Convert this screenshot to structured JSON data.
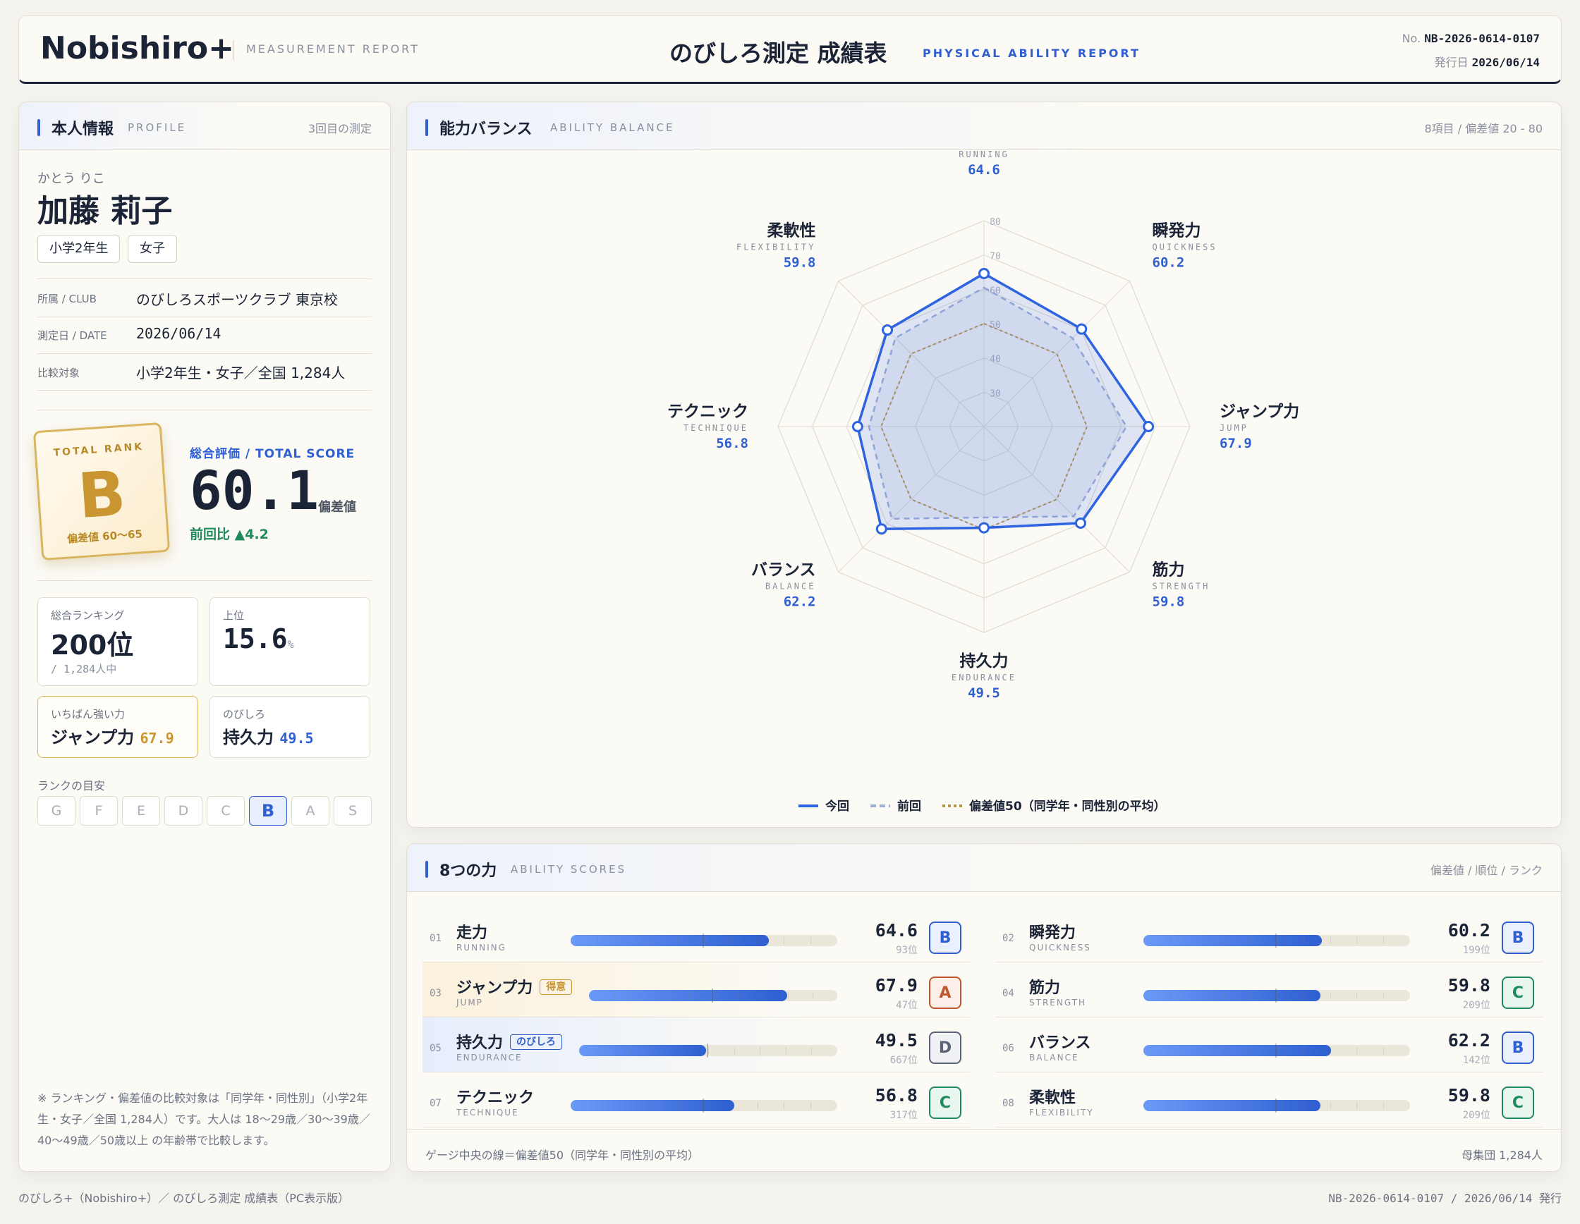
{
  "header": {
    "logo_main": "Nobishiro",
    "logo_plus": "+",
    "subtitle": "MEASUREMENT REPORT",
    "title": "のびしろ測定 成績表",
    "title_en": "PHYSICAL ABILITY REPORT",
    "no_label": "No.",
    "no_value": "NB-2026-0614-0107",
    "date_label": "発行日",
    "date_value": "2026/06/14"
  },
  "profile": {
    "title": "本人情報",
    "title_en": "PROFILE",
    "count": "3回目の測定",
    "kana": "かとう りこ",
    "name": "加藤 莉子",
    "grade": "小学2年生",
    "gender": "女子",
    "club_label": "所属 / CLUB",
    "club_value": "のびしろスポーツクラブ 東京校",
    "date_label": "測定日 / DATE",
    "date_value": "2026/06/14",
    "compare_label": "比較対象",
    "compare_value": "小学2年生・女子／全国 1,284人",
    "rank_card_label": "TOTAL RANK",
    "rank_card_grade": "B",
    "rank_card_range": "偏差値 60〜65",
    "total_label": "総合評価 / TOTAL SCORE",
    "total_value": "60.1",
    "total_unit": "偏差値",
    "diff": "前回比 ▲4.2",
    "ranking_label": "総合ランキング",
    "ranking_value": "200位",
    "ranking_sub": "/ 1,284人中",
    "top_label": "上位",
    "top_value": "15.6",
    "top_unit": "%",
    "strong_label": "いちばん強い力",
    "strong_name": "ジャンプ力",
    "strong_value": "67.9",
    "grow_label": "のびしろ",
    "grow_name": "持久力",
    "grow_value": "49.5",
    "guide_label": "ランクの目安",
    "grades": [
      "G",
      "F",
      "E",
      "D",
      "C",
      "B",
      "A",
      "S"
    ],
    "note": "※ ランキング・偏差値の比較対象は「同学年・同性別」（小学2年生・女子／全国 1,284人）です。大人は 18〜29歳／30〜39歳／40〜49歳／50歳以上 の年齢帯で比較します。"
  },
  "balance": {
    "title": "能力バランス",
    "title_en": "ABILITY BALANCE",
    "right": "8項目 / 偏差値 20 - 80",
    "legend_now": "今回",
    "legend_prev": "前回",
    "legend_avg": "偏差値50（同学年・同性別の平均）"
  },
  "chart_data": {
    "type": "radar",
    "axes": [
      {
        "name": "走力",
        "en": "RUNNING",
        "value": "64.6"
      },
      {
        "name": "瞬発力",
        "en": "QUICKNESS",
        "value": "60.2"
      },
      {
        "name": "ジャンプ力",
        "en": "JUMP",
        "value": "67.9"
      },
      {
        "name": "筋力",
        "en": "STRENGTH",
        "value": "59.8"
      },
      {
        "name": "持久力",
        "en": "ENDURANCE",
        "value": "49.5"
      },
      {
        "name": "バランス",
        "en": "BALANCE",
        "value": "62.2"
      },
      {
        "name": "テクニック",
        "en": "TECHNIQUE",
        "value": "56.8"
      },
      {
        "name": "柔軟性",
        "en": "FLEXIBILITY",
        "value": "59.8"
      }
    ],
    "range": [
      20,
      80
    ],
    "ticks": [
      "30",
      "40",
      "50",
      "60",
      "70",
      "80"
    ],
    "series": [
      {
        "name": "今回",
        "values": [
          64.6,
          60.2,
          67.9,
          59.8,
          49.5,
          62.2,
          56.8,
          59.8
        ],
        "color": "#2f64e0"
      },
      {
        "name": "前回",
        "values": [
          60.5,
          56.5,
          61.5,
          57.0,
          46.5,
          58.0,
          53.5,
          56.5
        ],
        "color": "#9fb0d8"
      },
      {
        "name": "偏差値50（同学年・同性別の平均）",
        "values": [
          50,
          50,
          50,
          50,
          50,
          50,
          50,
          50
        ],
        "color": "#b8934a"
      }
    ]
  },
  "scores": {
    "title": "8つの力",
    "title_en": "ABILITY SCORES",
    "right": "偏差値 / 順位 / ランク",
    "footer_left": "ゲージ中央の線＝偏差値50（同学年・同性別の平均）",
    "footer_right": "母集団 1,284人",
    "items": [
      {
        "no": "01",
        "name": "走力",
        "en": "RUNNING",
        "score": "64.6",
        "rank": "93位",
        "grade": "B",
        "fill": 0.744,
        "badge": ""
      },
      {
        "no": "02",
        "name": "瞬発力",
        "en": "QUICKNESS",
        "score": "60.2",
        "rank": "199位",
        "grade": "B",
        "fill": 0.67,
        "badge": ""
      },
      {
        "no": "03",
        "name": "ジャンプ力",
        "en": "JUMP",
        "score": "67.9",
        "rank": "47位",
        "grade": "A",
        "fill": 0.798,
        "badge": "得意"
      },
      {
        "no": "04",
        "name": "筋力",
        "en": "STRENGTH",
        "score": "59.8",
        "rank": "209位",
        "grade": "C",
        "fill": 0.664,
        "badge": ""
      },
      {
        "no": "05",
        "name": "持久力",
        "en": "ENDURANCE",
        "score": "49.5",
        "rank": "667位",
        "grade": "D",
        "fill": 0.492,
        "badge": "のびしろ"
      },
      {
        "no": "06",
        "name": "バランス",
        "en": "BALANCE",
        "score": "62.2",
        "rank": "142位",
        "grade": "B",
        "fill": 0.703,
        "badge": ""
      },
      {
        "no": "07",
        "name": "テクニック",
        "en": "TECHNIQUE",
        "score": "56.8",
        "rank": "317位",
        "grade": "C",
        "fill": 0.613,
        "badge": ""
      },
      {
        "no": "08",
        "name": "柔軟性",
        "en": "FLEXIBILITY",
        "score": "59.8",
        "rank": "209位",
        "grade": "C",
        "fill": 0.664,
        "badge": ""
      }
    ]
  },
  "footer": {
    "left": "のびしろ+（Nobishiro+）／ のびしろ測定 成績表（PC表示版）",
    "right": "NB-2026-0614-0107 / 2026/06/14 発行"
  }
}
